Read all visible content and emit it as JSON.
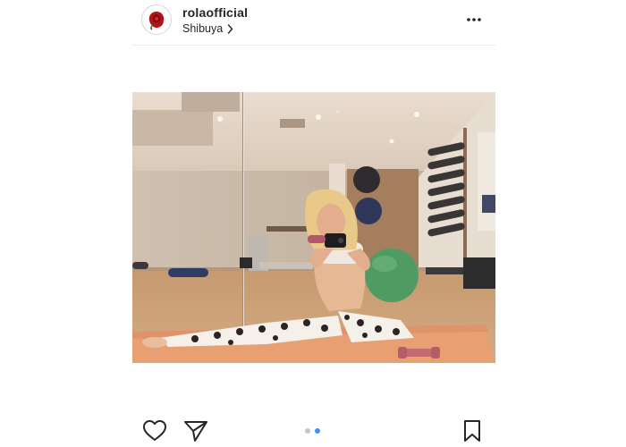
{
  "post": {
    "username": "rolaofficial",
    "location": "Shibuya",
    "location_chevron": "chevron-right-icon",
    "more_icon": "more-horizontal-icon",
    "avatar_icon": "rose-icon",
    "image_alt": "Woman taking a mirror selfie doing a split on a yoga mat in a gym"
  },
  "carousel": {
    "count": 2,
    "active_index": 1,
    "active_color": "#3897f0",
    "inactive_color": "#c7c7c7"
  },
  "actions": {
    "like_icon": "heart-icon",
    "share_icon": "paper-plane-icon",
    "save_icon": "bookmark-icon"
  }
}
